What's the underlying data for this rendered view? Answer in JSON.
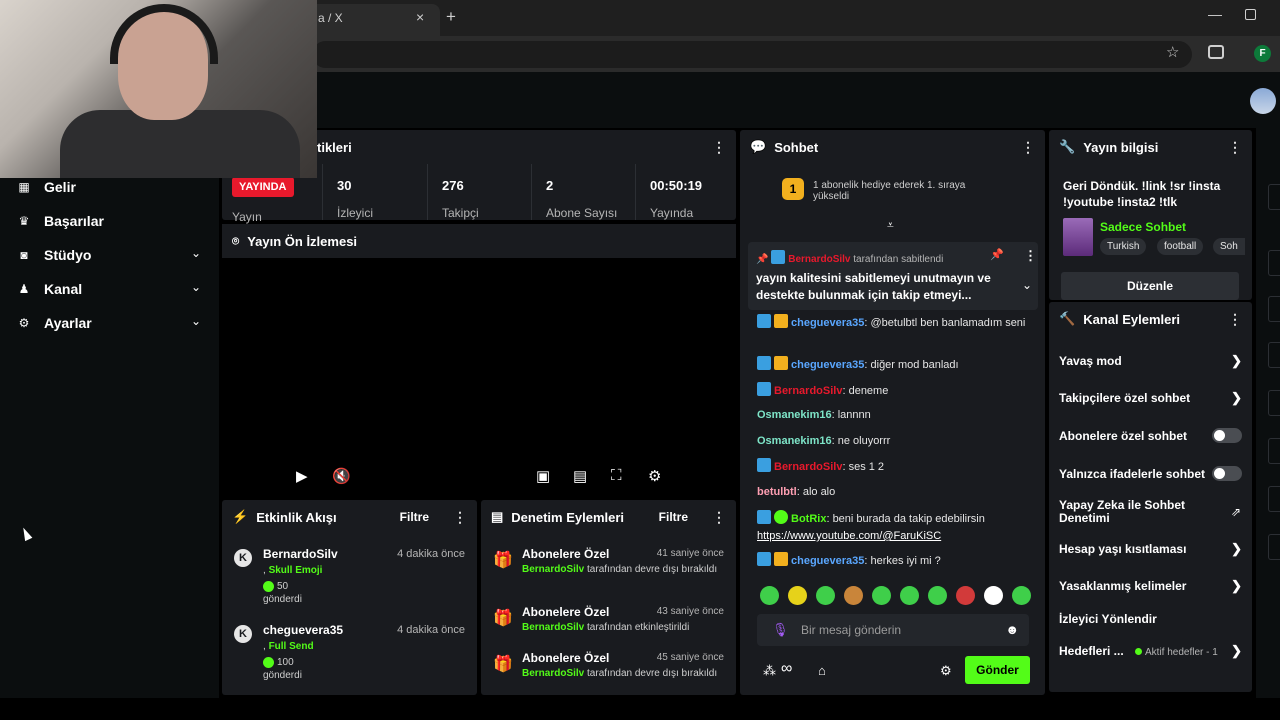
{
  "browser": {
    "tab_title": "a / X",
    "tab_close": "×",
    "new_tab": "+",
    "minimize": "—",
    "profile_initial": "F",
    "star": "☆"
  },
  "sidebar": {
    "items": [
      {
        "label": "Gelir",
        "icon": "money-icon",
        "glyph": "▦",
        "chevron": false
      },
      {
        "label": "Başarılar",
        "icon": "trophy-icon",
        "glyph": "🏆",
        "chevron": false
      },
      {
        "label": "Stüdyo",
        "icon": "studio-icon",
        "glyph": "◙",
        "chevron": true
      },
      {
        "label": "Kanal",
        "icon": "channel-icon",
        "glyph": "♟",
        "chevron": true
      },
      {
        "label": "Ayarlar",
        "icon": "gear-icon",
        "glyph": "⚙",
        "chevron": true
      }
    ],
    "chevron_glyph": "⌄"
  },
  "stats": {
    "title_partial": "tikleri",
    "live_badge": "YAYINDA",
    "yayin_label": "Yayın",
    "cells": [
      {
        "value": "30",
        "label": "İzleyici"
      },
      {
        "value": "276",
        "label": "Takipçi"
      },
      {
        "value": "2",
        "label": "Abone Sayısı"
      },
      {
        "value": "00:50:19",
        "label": "Yayında"
      }
    ]
  },
  "preview": {
    "title": "Yayın Ön İzlemesi"
  },
  "activity": {
    "title": "Etkinlik Akışı",
    "filter": "Filtre",
    "items": [
      {
        "user": "BernardoSilv",
        "time": "4 dakika önce",
        "item": "Skull Emoji",
        "amount": "50",
        "sent": "gönderdi"
      },
      {
        "user": "cheguevera35",
        "time": "4 dakika önce",
        "item": "Full Send",
        "amount": "100",
        "sent": "gönderdi"
      }
    ]
  },
  "moderation": {
    "title": "Denetim Eylemleri",
    "filter": "Filtre",
    "items": [
      {
        "title": "Abonelere Özel",
        "time": "41 saniye önce",
        "user": "BernardoSilv",
        "action": "tarafından devre dışı bırakıldı"
      },
      {
        "title": "Abonelere Özel",
        "time": "43 saniye önce",
        "user": "BernardoSilv",
        "action": "tarafından etkinleştirildi"
      },
      {
        "title": "Abonelere Özel",
        "time": "45 saniye önce",
        "user": "BernardoSilv",
        "action": "tarafından devre dışı bırakıldı"
      }
    ]
  },
  "chat": {
    "title": "Sohbet",
    "gift_number": "1",
    "gift_text": "1 abonelik hediye ederek 1. sıraya yükseldi",
    "pinned_by_user": "BernardoSilv",
    "pinned_by_text": "tarafından sabitlendi",
    "pinned_message": "yayın kalitesini sabitlemeyi unutmayın ve destekte bulunmak için takip etmeyi...",
    "messages": [
      {
        "user": "cheguevera35",
        "text": ": @betulbtl ben banlamadım seni"
      },
      {
        "user": "cheguevera35",
        "text": ": diğer mod banladı"
      },
      {
        "user": "BernardoSilv",
        "text": ": deneme"
      },
      {
        "user": "Osmanekim16",
        "text": ": lannnn"
      },
      {
        "user": "Osmanekim16",
        "text": ": ne oluyorrr"
      },
      {
        "user": "BernardoSilv",
        "text": ": ses 1 2"
      },
      {
        "user": "betulbtl",
        "text": ": alo alo"
      },
      {
        "user": "BotRix",
        "text": ": beni burada da takip edebilirsin",
        "link": "https://www.youtube.com/@FaruKiSC"
      },
      {
        "user": "cheguevera35",
        "text": ": herkes iyi mi ?"
      }
    ],
    "emote_colors": [
      "#3fcf4a",
      "#e6d21a",
      "#3fcf4a",
      "#c9853a",
      "#3fcf4a",
      "#3fcf4a",
      "#3fcf4a",
      "#d23a3a",
      "#ffffff",
      "#3fcf4a"
    ],
    "input_placeholder": "Bir mesaj gönderin",
    "send_label": "Gönder",
    "infinity": "∞"
  },
  "info": {
    "title": "Yayın bilgisi",
    "stream_title": "Geri Döndük. !link !sr !insta !youtube !insta2 !tlk",
    "category": "Sadece Sohbet",
    "tags": [
      "Turkish",
      "football",
      "Soh"
    ],
    "edit_label": "Düzenle"
  },
  "actions": {
    "title": "Kanal Eylemleri",
    "items": [
      {
        "label": "Yavaş mod",
        "control": "chevron"
      },
      {
        "label": "Takipçilere özel sohbet",
        "control": "chevron"
      },
      {
        "label": "Abonelere özel sohbet",
        "control": "toggle"
      },
      {
        "label": "Yalnızca ifadelerle sohbet",
        "control": "toggle"
      },
      {
        "label": "Yapay Zeka ile Sohbet Denetimi",
        "control": "external"
      },
      {
        "label": "Hesap yaşı kısıtlaması",
        "control": "chevron"
      },
      {
        "label": "Yasaklanmış kelimeler",
        "control": "chevron"
      },
      {
        "label": "İzleyici Yönlendir",
        "control": "none"
      },
      {
        "label": "Hedefleri ...",
        "control": "chevron",
        "status": "Aktif hedefler - 1"
      }
    ]
  },
  "colors": {
    "accent": "#53fc18",
    "live": "#e8192c",
    "panel": "#191b1f",
    "background": "#0b0e0f"
  }
}
